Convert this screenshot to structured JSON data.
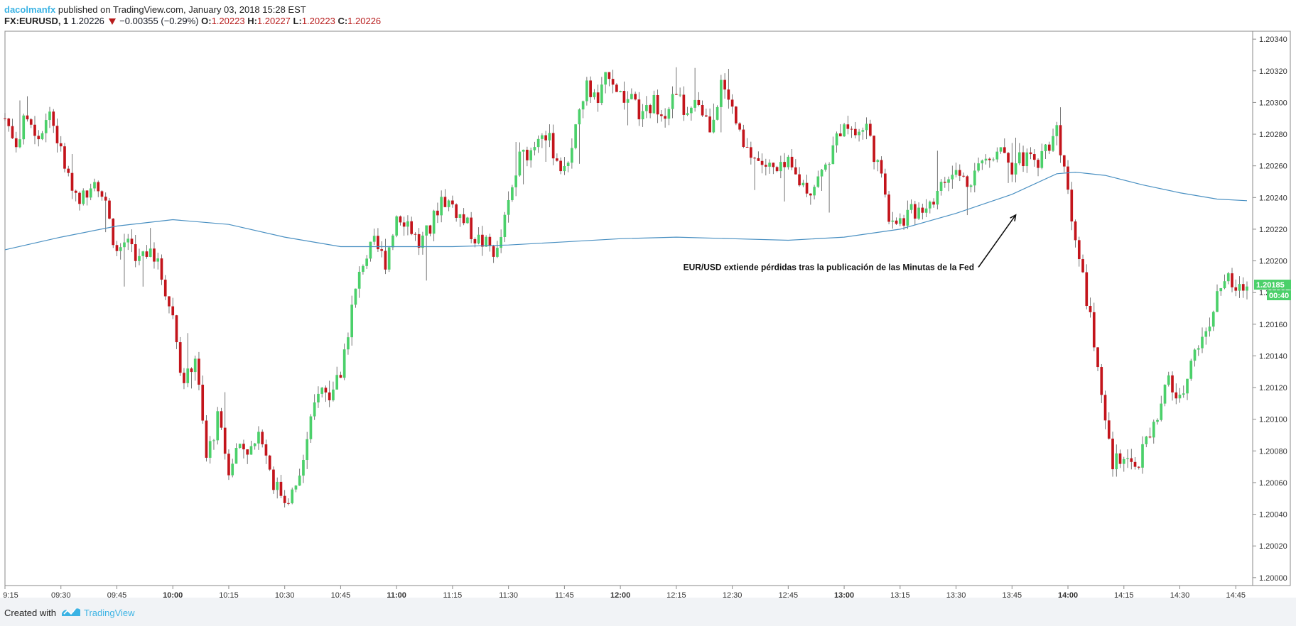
{
  "header": {
    "author": "dacolmanfx",
    "published": "published on TradingView.com, January 03, 2018 15:28 EST",
    "symbol": "FX:EURUSD, 1",
    "last": "1.20226",
    "change": "−0.00355 (−0.29%)",
    "open_label": "O:",
    "open": "1.20223",
    "high_label": "H:",
    "high": "1.20227",
    "low_label": "L:",
    "low": "1.20223",
    "close_label": "C:",
    "close": "1.20226"
  },
  "footer": {
    "created_with": "Created with",
    "brand": "TradingView",
    "logo_icon": "tradingview-logo-icon"
  },
  "colors": {
    "up": "#4bd06a",
    "down": "#c3141b",
    "ma": "#4a90c2",
    "accent": "#3bb3e4",
    "price_label_bg": "#4bd06a"
  },
  "chart_data": {
    "type": "candlestick",
    "interval": "1 minute",
    "xlim": [
      "09:15",
      "14:48"
    ],
    "ylim": [
      1.19995,
      1.20345
    ],
    "y_ticks": [
      "1.20000",
      "1.20020",
      "1.20040",
      "1.20060",
      "1.20080",
      "1.20100",
      "1.20120",
      "1.20140",
      "1.20160",
      "1.20180",
      "1.20200",
      "1.20220",
      "1.20240",
      "1.20260",
      "1.20280",
      "1.20300",
      "1.20320",
      "1.20340"
    ],
    "x_ticks": [
      {
        "label": "9:15",
        "bold": false
      },
      {
        "label": "09:30",
        "bold": false
      },
      {
        "label": "09:45",
        "bold": false
      },
      {
        "label": "10:00",
        "bold": true
      },
      {
        "label": "10:15",
        "bold": false
      },
      {
        "label": "10:30",
        "bold": false
      },
      {
        "label": "10:45",
        "bold": false
      },
      {
        "label": "11:00",
        "bold": true
      },
      {
        "label": "11:15",
        "bold": false
      },
      {
        "label": "11:30",
        "bold": false
      },
      {
        "label": "11:45",
        "bold": false
      },
      {
        "label": "12:00",
        "bold": true
      },
      {
        "label": "12:15",
        "bold": false
      },
      {
        "label": "12:30",
        "bold": false
      },
      {
        "label": "12:45",
        "bold": false
      },
      {
        "label": "13:00",
        "bold": true
      },
      {
        "label": "13:15",
        "bold": false
      },
      {
        "label": "13:30",
        "bold": false
      },
      {
        "label": "13:45",
        "bold": false
      },
      {
        "label": "14:00",
        "bold": true
      },
      {
        "label": "14:15",
        "bold": false
      },
      {
        "label": "14:30",
        "bold": false
      },
      {
        "label": "14:45",
        "bold": false
      }
    ],
    "close_path": [
      [
        "09:15",
        1.2029
      ],
      [
        "09:18",
        1.20275
      ],
      [
        "09:21",
        1.20292
      ],
      [
        "09:24",
        1.2028
      ],
      [
        "09:27",
        1.20295
      ],
      [
        "09:30",
        1.20268
      ],
      [
        "09:33",
        1.20245
      ],
      [
        "09:36",
        1.2024
      ],
      [
        "09:39",
        1.20255
      ],
      [
        "09:42",
        1.20235
      ],
      [
        "09:45",
        1.20205
      ],
      [
        "09:48",
        1.20215
      ],
      [
        "09:51",
        1.202
      ],
      [
        "09:54",
        1.2021
      ],
      [
        "09:57",
        1.2019
      ],
      [
        "10:00",
        1.20165
      ],
      [
        "10:03",
        1.2012
      ],
      [
        "10:06",
        1.2014
      ],
      [
        "10:09",
        1.20075
      ],
      [
        "10:12",
        1.201
      ],
      [
        "10:15",
        1.2007
      ],
      [
        "10:18",
        1.20085
      ],
      [
        "10:21",
        1.2008
      ],
      [
        "10:24",
        1.2009
      ],
      [
        "10:27",
        1.2006
      ],
      [
        "10:30",
        1.2005
      ],
      [
        "10:33",
        1.20055
      ],
      [
        "10:36",
        1.20085
      ],
      [
        "10:39",
        1.2012
      ],
      [
        "10:42",
        1.20115
      ],
      [
        "10:45",
        1.2013
      ],
      [
        "10:48",
        1.2017
      ],
      [
        "10:51",
        1.202
      ],
      [
        "10:54",
        1.2021
      ],
      [
        "10:57",
        1.202
      ],
      [
        "11:00",
        1.2023
      ],
      [
        "11:03",
        1.20225
      ],
      [
        "11:06",
        1.2021
      ],
      [
        "11:09",
        1.2022
      ],
      [
        "11:12",
        1.2024
      ],
      [
        "11:15",
        1.20235
      ],
      [
        "11:18",
        1.20225
      ],
      [
        "11:21",
        1.20215
      ],
      [
        "11:24",
        1.2021
      ],
      [
        "11:27",
        1.20205
      ],
      [
        "11:30",
        1.20235
      ],
      [
        "11:33",
        1.20265
      ],
      [
        "11:36",
        1.2027
      ],
      [
        "11:39",
        1.20285
      ],
      [
        "11:42",
        1.2027
      ],
      [
        "11:45",
        1.20255
      ],
      [
        "11:48",
        1.20285
      ],
      [
        "11:51",
        1.2031
      ],
      [
        "11:54",
        1.203
      ],
      [
        "11:57",
        1.2032
      ],
      [
        "12:00",
        1.20305
      ],
      [
        "12:03",
        1.203
      ],
      [
        "12:06",
        1.2029
      ],
      [
        "12:09",
        1.203
      ],
      [
        "12:12",
        1.20295
      ],
      [
        "12:15",
        1.20305
      ],
      [
        "12:18",
        1.2029
      ],
      [
        "12:21",
        1.203
      ],
      [
        "12:24",
        1.20285
      ],
      [
        "12:27",
        1.2031
      ],
      [
        "12:30",
        1.20295
      ],
      [
        "12:33",
        1.2027
      ],
      [
        "12:36",
        1.20265
      ],
      [
        "12:39",
        1.2026
      ],
      [
        "12:42",
        1.20255
      ],
      [
        "12:45",
        1.2026
      ],
      [
        "12:48",
        1.2025
      ],
      [
        "12:51",
        1.20245
      ],
      [
        "12:54",
        1.20255
      ],
      [
        "12:57",
        1.2027
      ],
      [
        "13:00",
        1.2029
      ],
      [
        "13:03",
        1.2028
      ],
      [
        "13:06",
        1.20285
      ],
      [
        "13:09",
        1.2026
      ],
      [
        "13:12",
        1.2023
      ],
      [
        "13:15",
        1.20225
      ],
      [
        "13:18",
        1.2023
      ],
      [
        "13:21",
        1.20235
      ],
      [
        "13:24",
        1.2024
      ],
      [
        "13:27",
        1.2025
      ],
      [
        "13:30",
        1.20255
      ],
      [
        "13:33",
        1.2025
      ],
      [
        "13:36",
        1.2026
      ],
      [
        "13:39",
        1.20265
      ],
      [
        "13:42",
        1.20275
      ],
      [
        "13:45",
        1.2026
      ],
      [
        "13:48",
        1.20265
      ],
      [
        "13:51",
        1.20262
      ],
      [
        "13:54",
        1.2027
      ],
      [
        "13:57",
        1.20285
      ],
      [
        "14:00",
        1.20245
      ],
      [
        "14:03",
        1.202
      ],
      [
        "14:06",
        1.20165
      ],
      [
        "14:09",
        1.2011
      ],
      [
        "14:12",
        1.2007
      ],
      [
        "14:15",
        1.2008
      ],
      [
        "14:18",
        1.20065
      ],
      [
        "14:21",
        1.20085
      ],
      [
        "14:24",
        1.201
      ],
      [
        "14:27",
        1.20125
      ],
      [
        "14:30",
        1.2011
      ],
      [
        "14:33",
        1.2014
      ],
      [
        "14:36",
        1.2015
      ],
      [
        "14:39",
        1.2017
      ],
      [
        "14:42",
        1.2019
      ],
      [
        "14:45",
        1.2018
      ],
      [
        "14:48",
        1.20185
      ]
    ],
    "moving_average": [
      [
        "09:15",
        1.20207
      ],
      [
        "09:30",
        1.20215
      ],
      [
        "09:45",
        1.20222
      ],
      [
        "10:00",
        1.20226
      ],
      [
        "10:15",
        1.20223
      ],
      [
        "10:30",
        1.20215
      ],
      [
        "10:45",
        1.20209
      ],
      [
        "11:00",
        1.20209
      ],
      [
        "11:15",
        1.20209
      ],
      [
        "11:30",
        1.2021
      ],
      [
        "11:45",
        1.20212
      ],
      [
        "12:00",
        1.20214
      ],
      [
        "12:15",
        1.20215
      ],
      [
        "12:30",
        1.20214
      ],
      [
        "12:45",
        1.20213
      ],
      [
        "13:00",
        1.20215
      ],
      [
        "13:15",
        1.2022
      ],
      [
        "13:30",
        1.2023
      ],
      [
        "13:45",
        1.20242
      ],
      [
        "13:57",
        1.20255
      ],
      [
        "14:02",
        1.20256
      ],
      [
        "14:10",
        1.20254
      ],
      [
        "14:20",
        1.20248
      ],
      [
        "14:30",
        1.20243
      ],
      [
        "14:40",
        1.20239
      ],
      [
        "14:48",
        1.20238
      ]
    ],
    "current_price_label": "1.20185",
    "countdown_label": "00:40",
    "annotation": "EUR/USD extiende pérdidas tras la publicación de las Minutas de la Fed"
  }
}
